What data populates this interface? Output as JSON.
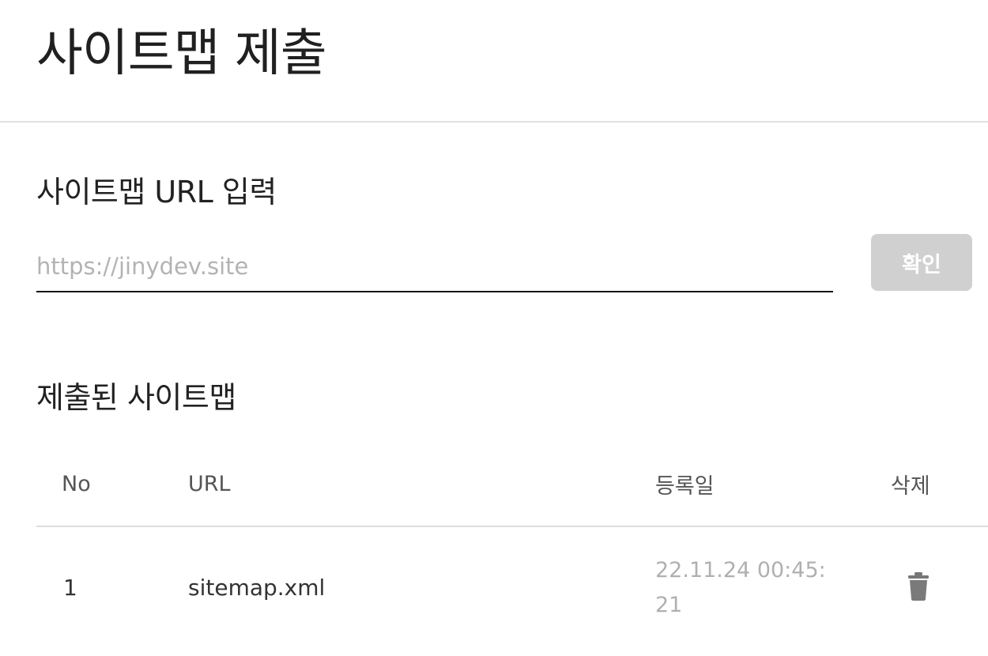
{
  "header": {
    "title": "사이트맵 제출"
  },
  "submit_section": {
    "title": "사이트맵 URL 입력",
    "input": {
      "value": "",
      "placeholder": "https://jinydev.site"
    },
    "confirm_label": "확인",
    "confirm_color": "#d0d0d0"
  },
  "list_section": {
    "title": "제출된 사이트맵",
    "columns": {
      "no": "No",
      "url": "URL",
      "date": "등록일",
      "delete": "삭제"
    },
    "rows": [
      {
        "no": "1",
        "url": "sitemap.xml",
        "date": "22.11.24 00:45:21",
        "delete_icon": "trash-icon"
      }
    ]
  }
}
